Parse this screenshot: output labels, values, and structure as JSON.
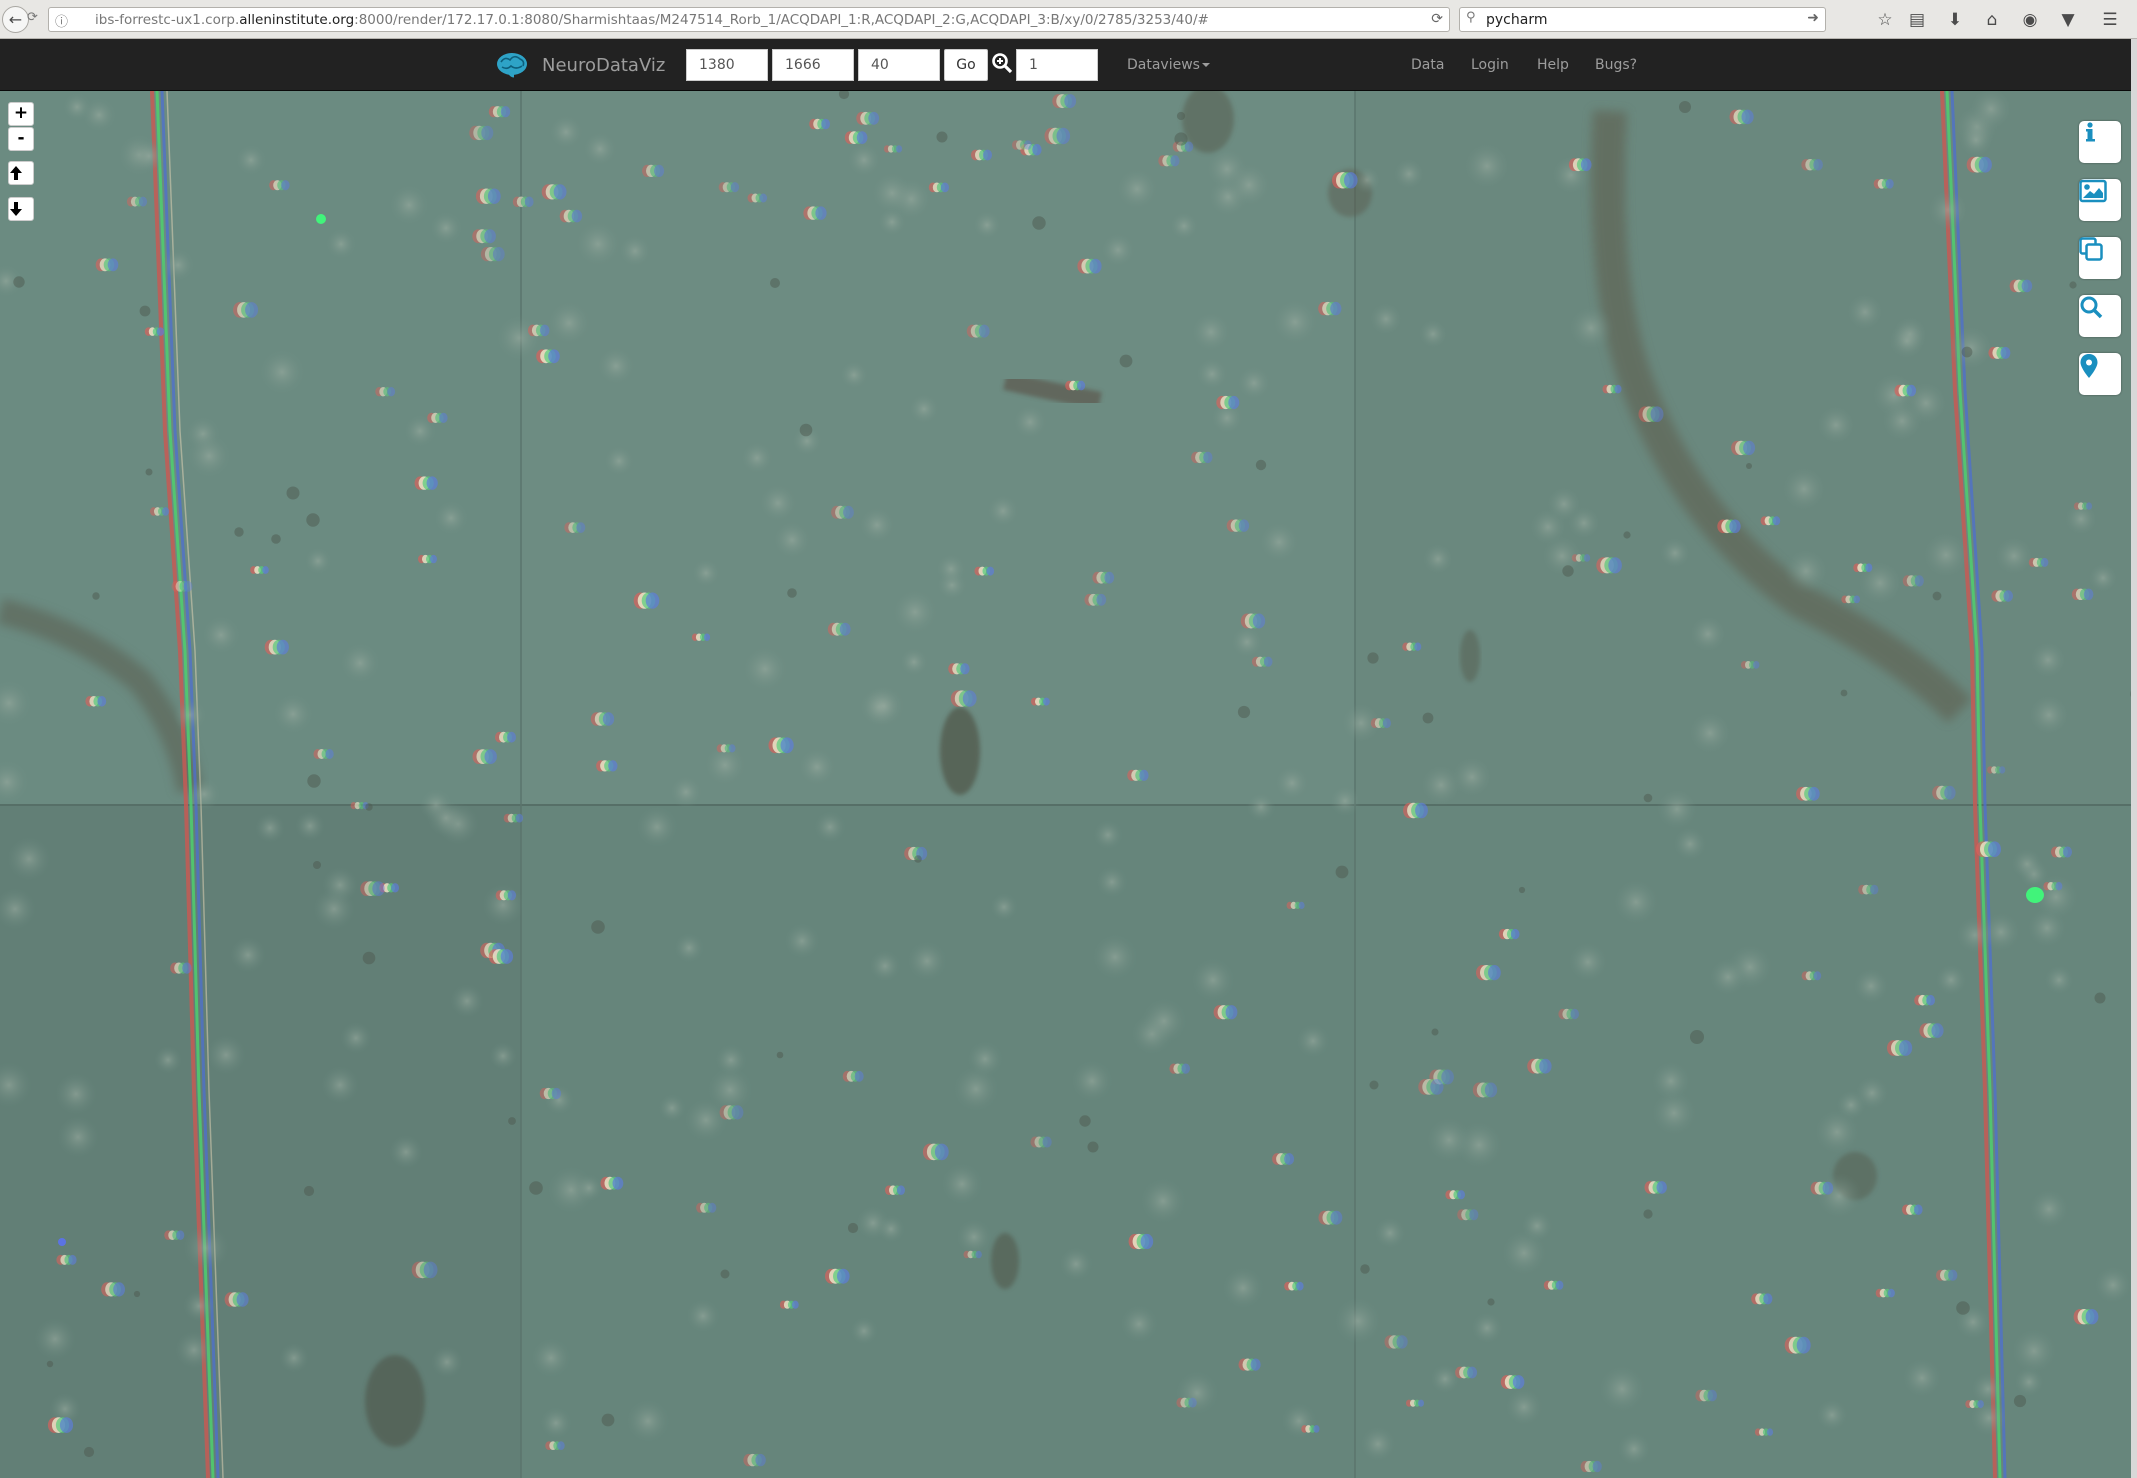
{
  "browser": {
    "url_prefix": "ibs-forrestc-ux1.corp.",
    "url_domain": "alleninstitute.org",
    "url_suffix": ":8000/render/172.17.0.1:8080/Sharmishtaas/M247514_Rorb_1/ACQDAPI_1:R,ACQDAPI_2:G,ACQDAPI_3:B/xy/0/2785/3253/40/#",
    "search_value": "pycharm"
  },
  "navbar": {
    "brand": "NeuroDataViz",
    "x_value": "1380",
    "y_value": "1666",
    "z_value": "40",
    "go_label": "Go",
    "zoom_value": "1",
    "dataviews_label": "Dataviews",
    "links": [
      "Data",
      "Login",
      "Help",
      "Bugs?"
    ]
  },
  "map_controls": {
    "zoom_in": "+",
    "zoom_out": "-"
  },
  "colors": {
    "navbar_bg": "#222222",
    "navbar_text": "#9d9d9d",
    "tissue": "#6a8a80",
    "side_button_icon": "#1a8fbf"
  },
  "icons": [
    "back-arrow-icon",
    "reload-icon",
    "info-icon",
    "search-icon",
    "arrow-right-icon",
    "star-icon",
    "clipboard-icon",
    "download-icon",
    "home-icon",
    "chat-icon",
    "pocket-icon",
    "menu-icon",
    "brain-logo-icon",
    "zoom-magnifier-icon",
    "arrow-up-icon",
    "arrow-down-icon",
    "image-icon",
    "copy-layers-icon",
    "location-pin-icon"
  ]
}
